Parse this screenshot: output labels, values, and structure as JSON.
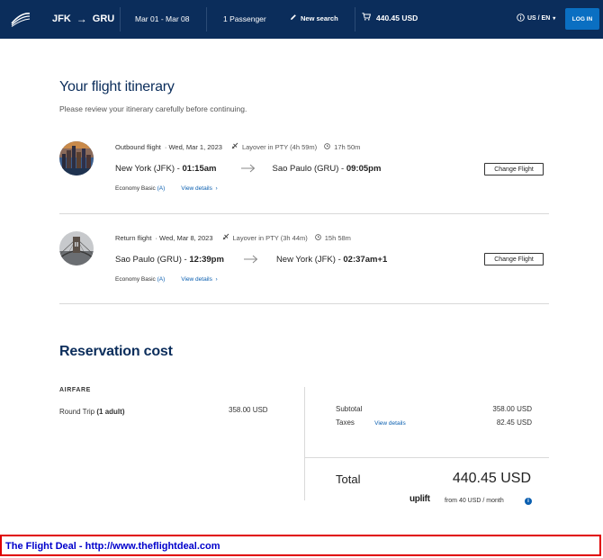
{
  "header": {
    "origin": "JFK",
    "destination": "GRU",
    "dates": "Mar 01 - Mar 08",
    "passengers": "1 Passenger",
    "new_search": "New search",
    "cart_total": "440.45 USD",
    "locale": "US / EN",
    "login": "LOG IN"
  },
  "itinerary": {
    "title": "Your flight itinerary",
    "subtitle": "Please review your itinerary carefully before continuing.",
    "flights": [
      {
        "label": "Outbound flight",
        "date": "· Wed, Mar 1, 2023",
        "layover": "Layover in PTY (4h 59m)",
        "duration": "17h 50m",
        "from_city": "New York (JFK)",
        "from_time": "01:15am",
        "to_city": "Sao Paulo (GRU)",
        "to_time": "09:05pm",
        "cabin": "Economy Basic",
        "fare_code": "(A)",
        "details_link": "View details",
        "change_button": "Change Flight"
      },
      {
        "label": "Return flight",
        "date": "· Wed, Mar 8, 2023",
        "layover": "Layover in PTY (3h 44m)",
        "duration": "15h 58m",
        "from_city": "Sao Paulo (GRU)",
        "from_time": "12:39pm",
        "to_city": "New York (JFK)",
        "to_time": "02:37am+1",
        "cabin": "Economy Basic",
        "fare_code": "(A)",
        "details_link": "View details",
        "change_button": "Change Flight"
      }
    ]
  },
  "reservation": {
    "title": "Reservation cost",
    "airfare_label": "AIRFARE",
    "trip_type": "Round Trip",
    "travelers": "(1 adult)",
    "airfare_amount": "358.00 USD",
    "subtotal_label": "Subtotal",
    "subtotal_amount": "358.00 USD",
    "taxes_label": "Taxes",
    "taxes_link": "View details",
    "taxes_amount": "82.45 USD",
    "total_label": "Total",
    "total_amount": "440.45 USD",
    "uplift_brand": "uplift",
    "uplift_text": "from 40 USD  / month"
  },
  "banner": {
    "text": "The Flight Deal - http://www.theflightdeal.com"
  },
  "colors": {
    "header_bg": "#0b2d5b",
    "accent": "#0a6fc2",
    "link": "#0a5fb0",
    "banner_border": "#e00000",
    "banner_text": "#0000cc"
  }
}
